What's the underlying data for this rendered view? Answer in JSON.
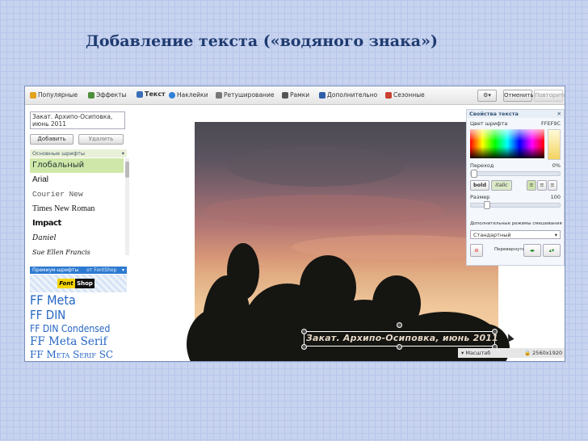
{
  "slide": {
    "title": "Добавление текста («водяного знака»)"
  },
  "toolbar": {
    "tabs": [
      "Популярные",
      "Эффекты",
      "Текст",
      "Наклейки",
      "Ретуширование",
      "Рамки",
      "Дополнительно",
      "Сезонные"
    ],
    "undo_label": "Отменить",
    "redo_label": "Повторить"
  },
  "left_panel": {
    "text_value": "Закат. Архипо-Осиповка, июнь 2011",
    "add_label": "Добавить",
    "delete_label": "Удалить",
    "basic_fonts_header": "Основные шрифты",
    "basic_fonts": [
      "Глобальный",
      "Arial",
      "Courier New",
      "Times New Roman",
      "Impact",
      "Daniel",
      "Sue Ellen Francis"
    ],
    "premium_header": "Премиум-шрифты",
    "premium_source": "от FontShop",
    "logo_left": "Font",
    "logo_right": "Shop",
    "premium_fonts": [
      "FF Meta",
      "FF DIN",
      "FF DIN Condensed",
      "FF Meta Serif",
      "FF Meta Serif SC"
    ]
  },
  "canvas": {
    "caption": "Закат. Архипо-Осиповка, июнь 2011"
  },
  "right_panel": {
    "header": "Свойства текста",
    "color_label": "Цвет шрифта",
    "color_value": "FFEF9C",
    "opacity_label": "Переход",
    "opacity_value": "0%",
    "bold_label": "bold",
    "italic_label": "italic",
    "size_label": "Размер",
    "size_value": "100",
    "blend_label": "Дополнительные режимы смешивания",
    "blend_value": "Стандартный",
    "flip_label": "Перевернуть:"
  },
  "statusbar": {
    "zoom_label": "Масштаб",
    "dimensions": "2560x1920"
  }
}
